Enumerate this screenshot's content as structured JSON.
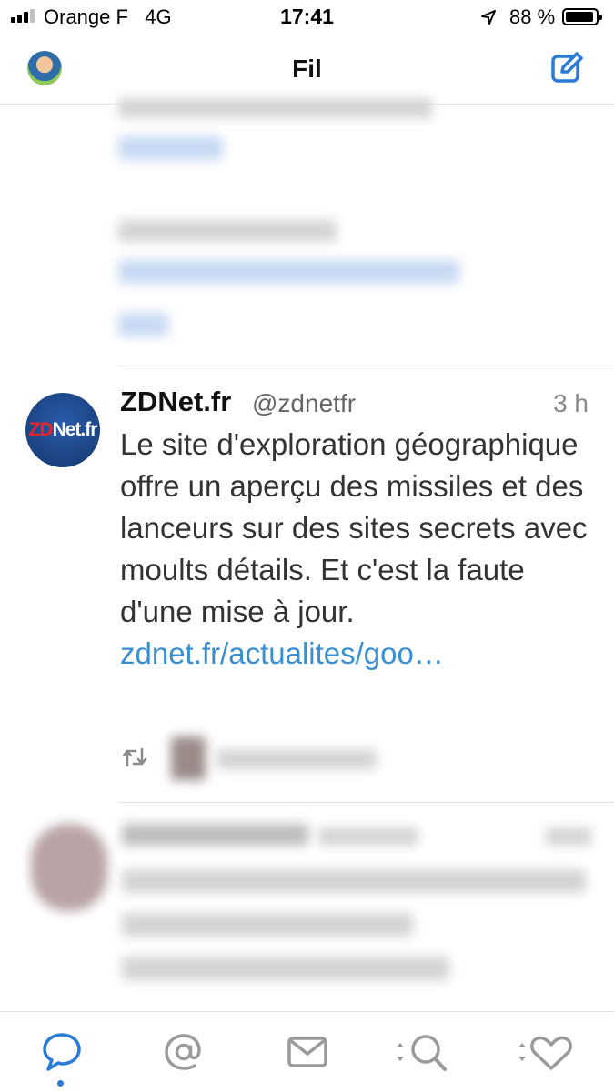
{
  "status_bar": {
    "carrier": "Orange F",
    "network": "4G",
    "time": "17:41",
    "battery": "88 %"
  },
  "nav": {
    "title": "Fil"
  },
  "tweet": {
    "name": "ZDNet.fr",
    "handle": "@zdnetfr",
    "time": "3 h",
    "text": "Le site d'exploration géographique offre un aperçu des missiles et des lanceurs sur des sites secrets avec moults détails. Et c'est la faute d'une mise à jour.",
    "link": "zdnet.fr/actualites/goo…",
    "avatar_text_red": "ZD",
    "avatar_text_white": "Net.fr"
  },
  "tabs": [
    "timeline-icon",
    "mentions-icon",
    "messages-icon",
    "search-icon",
    "favorites-icon"
  ],
  "colors": {
    "accent": "#2a7bd6",
    "link": "#3a8fd1",
    "zdnet_red": "#e8242b",
    "zdnet_blue": "#1f4b8f"
  }
}
